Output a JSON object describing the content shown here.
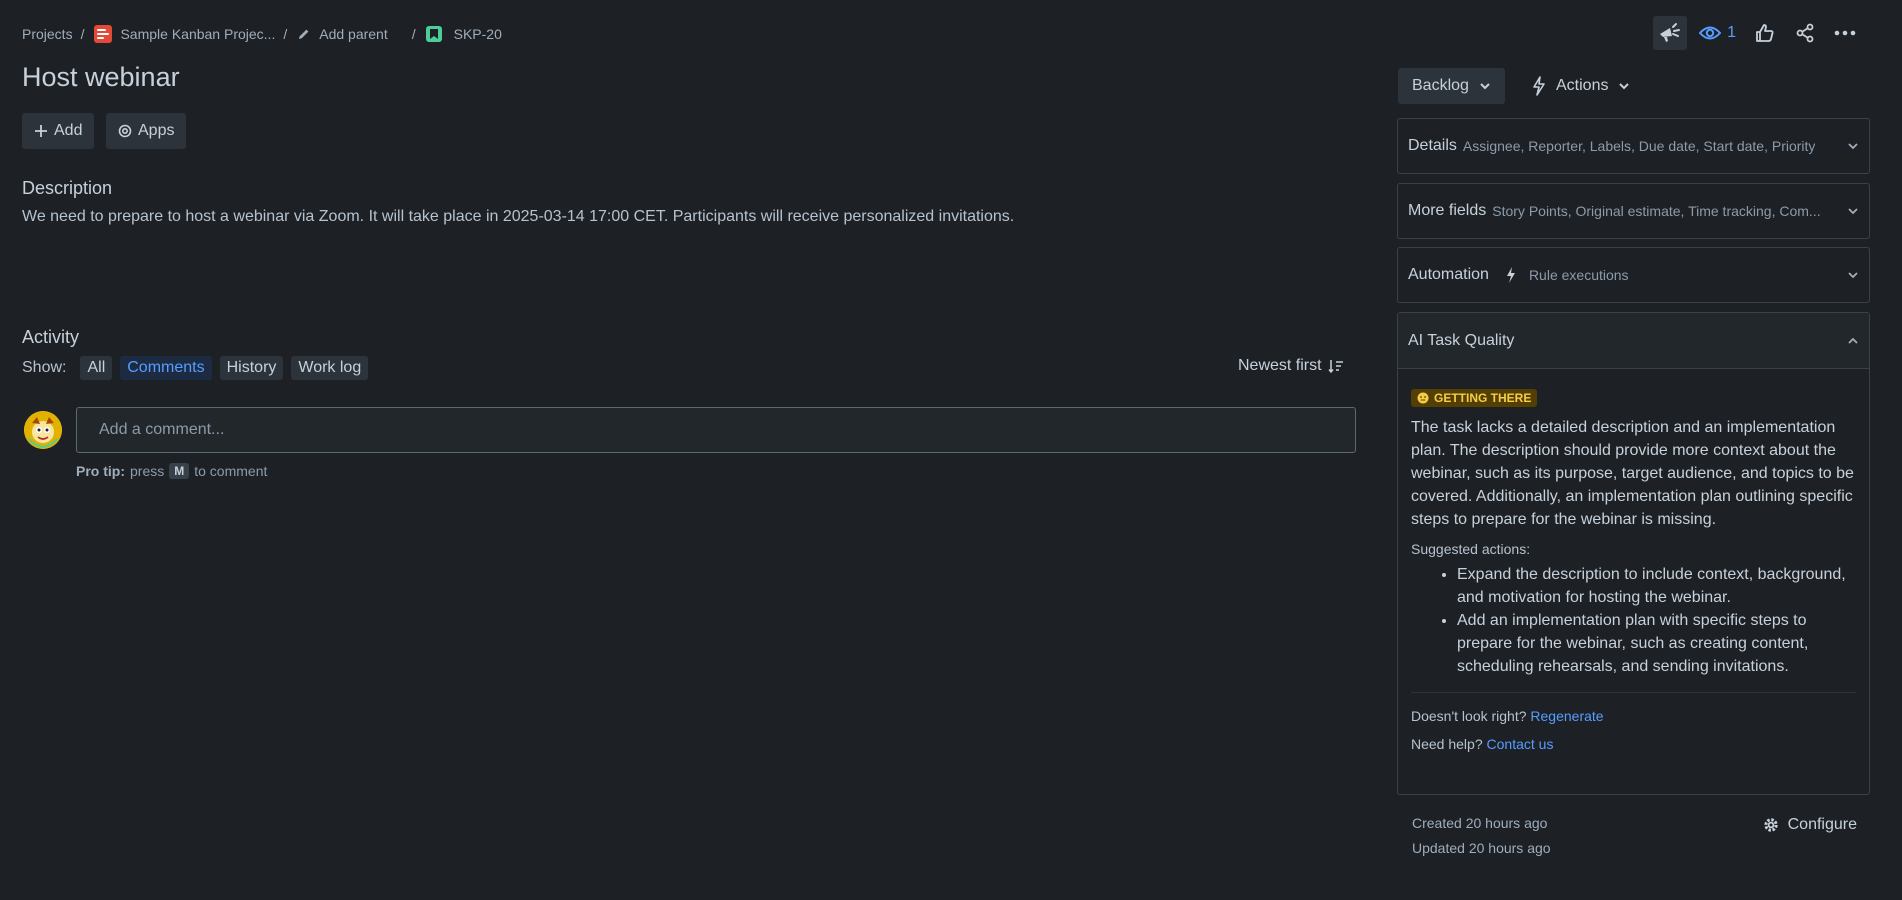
{
  "breadcrumb": {
    "projects": "Projects",
    "project_name": "Sample Kanban Projec...",
    "add_parent": "Add parent",
    "issue_key": "SKP-20",
    "separator": "/"
  },
  "header": {
    "watch_count": "1"
  },
  "issue": {
    "title": "Host webinar",
    "add_label": "Add",
    "apps_label": "Apps"
  },
  "description": {
    "heading": "Description",
    "text": "We need to prepare to host a webinar via Zoom. It will take place in 2025-03-14 17:00 CET. Participants will receive personalized invitations."
  },
  "activity": {
    "heading": "Activity",
    "show_label": "Show:",
    "filters": [
      "All",
      "Comments",
      "History",
      "Work log"
    ],
    "selected_filter": "Comments",
    "sort_label": "Newest first",
    "comment_placeholder": "Add a comment...",
    "protip_bold": "Pro tip:",
    "protip_press": "press",
    "protip_key": "M",
    "protip_rest": "to comment"
  },
  "sidebar": {
    "status": "Backlog",
    "actions": "Actions",
    "details_title": "Details",
    "details_sub": "Assignee, Reporter, Labels, Due date, Start date, Priority",
    "more_title": "More fields",
    "more_sub": "Story Points, Original estimate, Time tracking, Com...",
    "automation_title": "Automation",
    "automation_sub": "Rule executions"
  },
  "ai_quality": {
    "title": "AI Task Quality",
    "badge": "GETTING THERE",
    "summary": "The task lacks a detailed description and an implementation plan. The description should provide more context about the webinar, such as its purpose, target audience, and topics to be covered. Additionally, an implementation plan outlining specific steps to prepare for the webinar is missing.",
    "suggested_heading": "Suggested actions:",
    "suggestions": [
      "Expand the description to include context, background, and motivation for hosting the webinar.",
      "Add an implementation plan with specific steps to prepare for the webinar, such as creating content, scheduling rehearsals, and sending invitations."
    ],
    "doesnt_look_right": "Doesn't look right?",
    "regenerate": "Regenerate",
    "need_help": "Need help?",
    "contact_us": "Contact us"
  },
  "footer": {
    "created": "Created 20 hours ago",
    "updated": "Updated 20 hours ago",
    "configure": "Configure"
  },
  "colors": {
    "background": "#1d2125",
    "accent": "#579dff",
    "badge_bg": "#533f04",
    "badge_text": "#f5cd47"
  }
}
